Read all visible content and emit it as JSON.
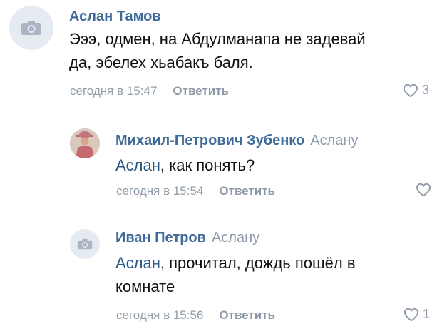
{
  "comments": [
    {
      "author": "Аслан Тамов",
      "reply_to": "",
      "mention": "",
      "text": "Эээ, одмен, на Абдулманапа не задевай да, эбелех хьабакъ баля.",
      "time": "сегодня в 15:47",
      "reply_label": "Ответить",
      "likes": "3",
      "avatar": "camera-placeholder-icon"
    },
    {
      "author": "Михаил-Петрович Зубенко",
      "reply_to": "Аслану",
      "mention": "Аслан",
      "text": ", как понять?",
      "time": "сегодня в 15:54",
      "reply_label": "Ответить",
      "likes": "",
      "avatar": "user-photo"
    },
    {
      "author": "Иван Петров",
      "reply_to": "Аслану",
      "mention": "Аслан",
      "text": ", прочитал, дождь пошёл в комнате",
      "time": "сегодня в 15:56",
      "reply_label": "Ответить",
      "likes": "1",
      "avatar": "camera-placeholder-icon"
    }
  ],
  "colors": {
    "link": "#3f6b9a",
    "mention": "#2a5885",
    "meta": "#939ea9",
    "avatar_bg": "#e5ebf1"
  }
}
